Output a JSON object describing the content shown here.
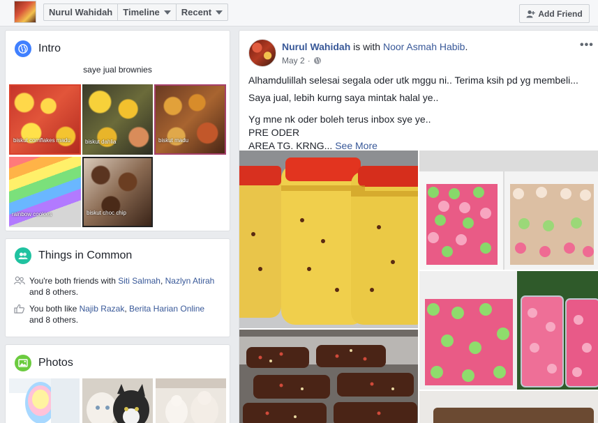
{
  "header": {
    "profile_name": "Nurul Wahidah",
    "tab_timeline": "Timeline",
    "tab_recent": "Recent",
    "add_friend": "Add Friend"
  },
  "intro": {
    "title": "Intro",
    "bio": "saye jual brownies",
    "featured_captions": [
      "biskut cornflakes madu",
      "biskut dahlia",
      "biskut madu",
      "rainbow cookies",
      "biskut choc chip"
    ]
  },
  "common": {
    "title": "Things in Common",
    "friends_prefix": "You're both friends with ",
    "friend1": "Siti Salmah",
    "friend_sep": ", ",
    "friend2": "Nazlyn Atirah",
    "friends_suffix": "and 8 others.",
    "likes_prefix": "You both like ",
    "like1": "Najib Razak",
    "like_sep": ", ",
    "like2": "Berita Harian Online",
    "likes_suffix": "and 8 others."
  },
  "photos": {
    "title": "Photos"
  },
  "post": {
    "author": "Nurul Wahidah",
    "with_text": " is with ",
    "tagged": "Noor Asmah Habib",
    "tagged_suffix": ".",
    "date": "May 2",
    "line1": "Alhamdulillah selesai segala oder utk mggu ni.. Terima ksih pd yg membeli...",
    "line2": "Saya jual, lebih kurng saya mintak halal ye..",
    "line3": "Yg mne nk oder boleh terus inbox sye ye..",
    "line4": "PRE ODER",
    "line5": "AREA TG. KRNG... ",
    "see_more": "See More"
  },
  "icons": {
    "intro": "globe-icon",
    "common": "people-icon",
    "photos": "photo-icon",
    "friends": "friends-icon",
    "likes": "thumbs-up-icon",
    "privacy": "globe-small-icon",
    "more": "more-dots-icon",
    "add_friend": "add-person-icon"
  },
  "colors": {
    "link": "#385898",
    "intro_icon": "#4080ff",
    "common_icon": "#20c2a0",
    "photos_icon": "#6bcb3f"
  }
}
